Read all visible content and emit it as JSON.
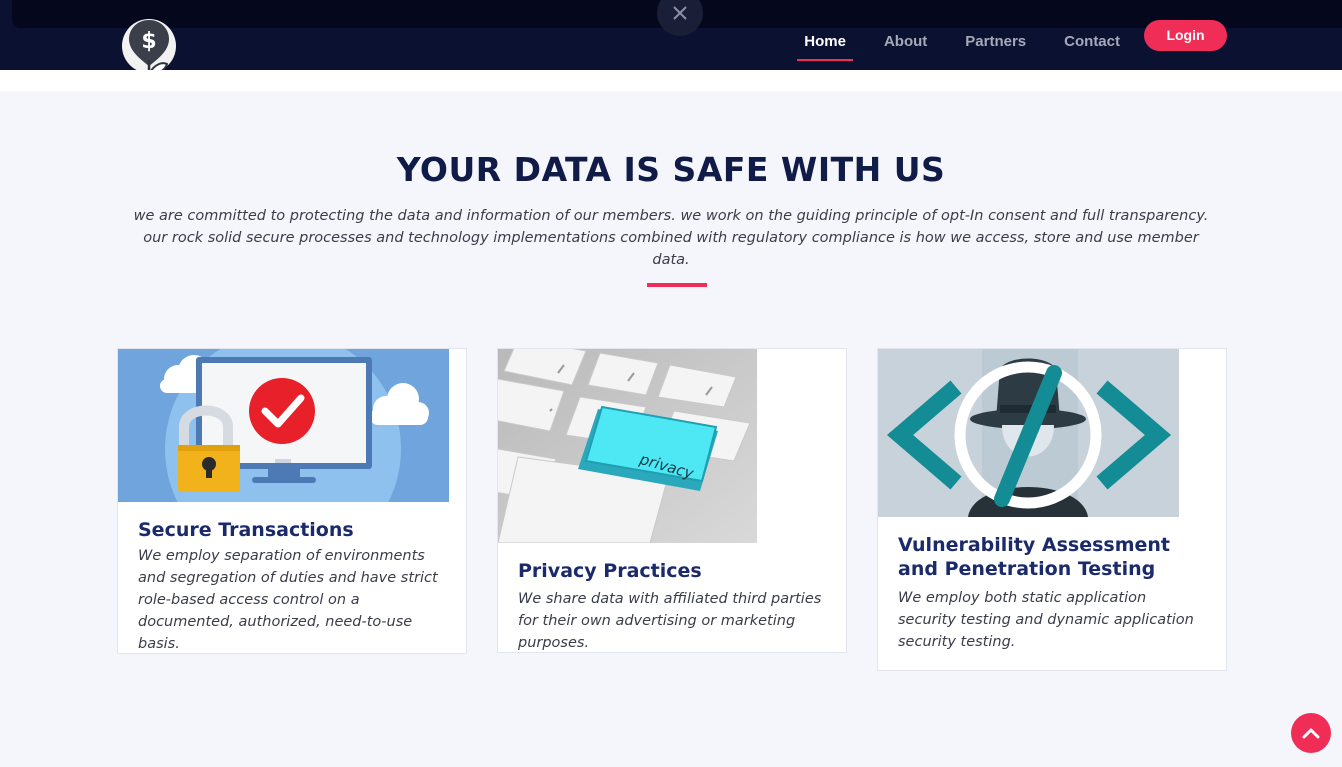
{
  "nav": {
    "links": [
      {
        "label": "Home",
        "active": true
      },
      {
        "label": "About"
      },
      {
        "label": "Partners"
      },
      {
        "label": "Contact"
      }
    ],
    "login_label": "Login",
    "logo_icon": "dollar-sprout-icon",
    "close_icon": "close-icon"
  },
  "section": {
    "title": "YOUR DATA IS SAFE WITH US",
    "intro": "we are committed to protecting the data and information of our members. we work on the guiding principle of opt-In consent and full transparency. our rock solid secure processes and technology implementations combined with regulatory compliance is how we access, store and use member data."
  },
  "cards": [
    {
      "title": "Secure Transactions",
      "text": "We employ separation of environments and segregation of duties and have strict role-based access control on a documented, authorized, need-to-use basis.",
      "image_icon": "lock-monitor-check-illustration"
    },
    {
      "title": "Privacy Practices",
      "text": "We share data with affiliated third parties for their own advertising or marketing purposes.",
      "image_icon": "privacy-keyboard-illustration",
      "key_label": "privacy"
    },
    {
      "title": "Vulnerability Assessment and Penetration Testing",
      "text": "We employ both static application security testing and dynamic application security testing.",
      "image_icon": "hacker-code-illustration"
    }
  ],
  "scroll_top_icon": "chevron-up-icon",
  "colors": {
    "navbar": "#0b1130",
    "accent": "#ef2d56",
    "heading": "#101b48",
    "card_title": "#1b2a6b",
    "background": "#f5f6fb"
  }
}
